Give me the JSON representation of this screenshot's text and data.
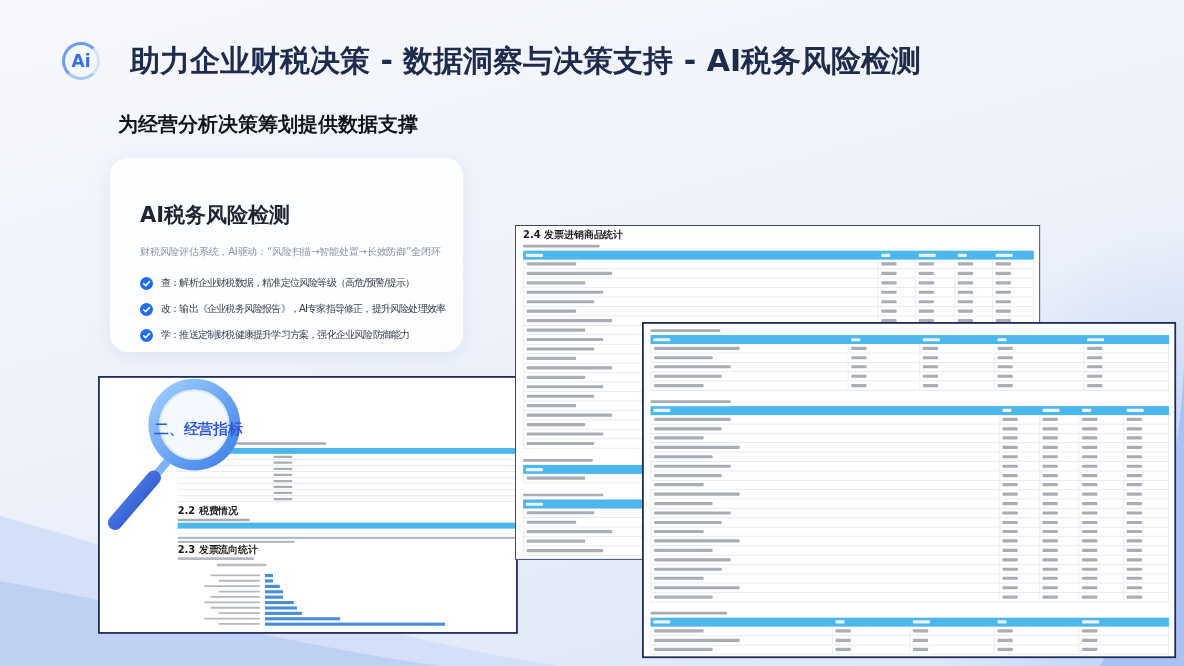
{
  "header": {
    "logo": "Ai",
    "title": "助力企业财税决策 - 数据洞察与决策支持 - AI税务风险检测",
    "subtitle": "为经营分析决策筹划提供数据支撑"
  },
  "feature_card": {
    "title": "AI税务风险检测",
    "description": "财税风险评估系统，AI驱动：“风险扫描→智能处置→长效防御”全闭环",
    "points": [
      "查：解析企业财税数据，精准定位风险等级（高危/预警/提示）",
      "改：输出《企业税务风险报告》，AI专家指导修正，提升风险处理效率",
      "学：推送定制财税健康提升学习方案，强化企业风险防御能力"
    ]
  },
  "documents": [
    {
      "kind": "table_page",
      "heading": "2.4 发票进销商品统计"
    },
    {
      "kind": "table_page"
    },
    {
      "kind": "report_page",
      "magnifier_label": "二、经营指标",
      "section_titles": [
        "2.2 税费情况",
        "2.3 发票流向统计"
      ]
    }
  ]
}
